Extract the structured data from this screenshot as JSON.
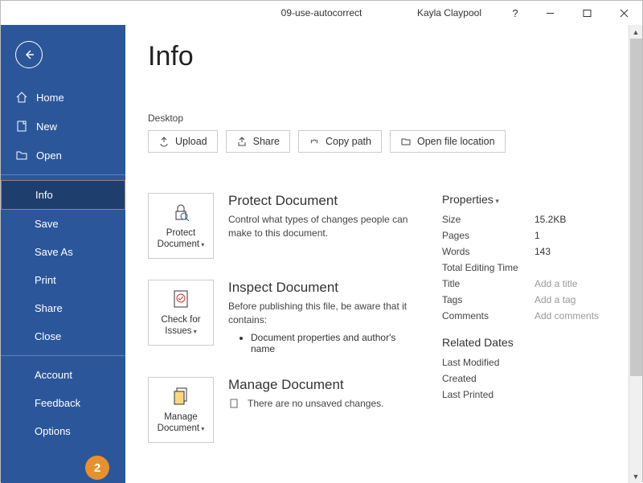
{
  "titlebar": {
    "doc_title": "09-use-autocorrect",
    "user_name": "Kayla Claypool"
  },
  "sidebar": {
    "home": "Home",
    "new": "New",
    "open": "Open",
    "info": "Info",
    "save": "Save",
    "save_as": "Save As",
    "print": "Print",
    "share": "Share",
    "close": "Close",
    "account": "Account",
    "feedback": "Feedback",
    "options": "Options"
  },
  "page": {
    "title": "Info",
    "location": "Desktop"
  },
  "actions": {
    "upload": "Upload",
    "share": "Share",
    "copy_path": "Copy path",
    "open_loc": "Open file location"
  },
  "protect": {
    "btn": "Protect Document",
    "heading": "Protect Document",
    "desc": "Control what types of changes people can make to this document."
  },
  "inspect": {
    "btn": "Check for Issues",
    "heading": "Inspect Document",
    "desc": "Before publishing this file, be aware that it contains:",
    "item1": "Document properties and author's name"
  },
  "manage": {
    "btn": "Manage Document",
    "heading": "Manage Document",
    "desc": "There are no unsaved changes."
  },
  "props": {
    "heading": "Properties",
    "size_l": "Size",
    "size_v": "15.2KB",
    "pages_l": "Pages",
    "pages_v": "1",
    "words_l": "Words",
    "words_v": "143",
    "editing_l": "Total Editing Time",
    "editing_v": "",
    "title_l": "Title",
    "title_v": "Add a title",
    "tags_l": "Tags",
    "tags_v": "Add a tag",
    "comments_l": "Comments",
    "comments_v": "Add comments",
    "related_heading": "Related Dates",
    "modified_l": "Last Modified",
    "created_l": "Created",
    "printed_l": "Last Printed"
  },
  "badge": "2"
}
